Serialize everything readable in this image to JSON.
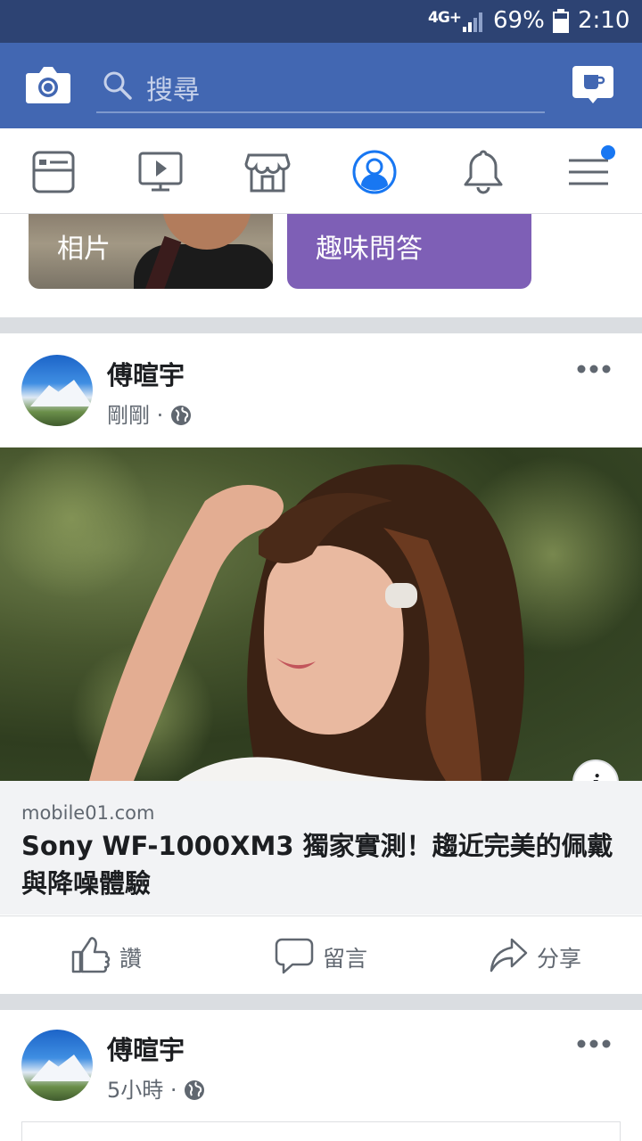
{
  "status_bar": {
    "network": "4G+",
    "battery_percent": "69%",
    "time": "2:10"
  },
  "header": {
    "search_placeholder": "搜尋"
  },
  "nav": {
    "tabs": [
      {
        "icon": "news-feed-icon"
      },
      {
        "icon": "watch-icon"
      },
      {
        "icon": "marketplace-icon"
      },
      {
        "icon": "profile-icon",
        "active": true
      },
      {
        "icon": "notifications-icon"
      },
      {
        "icon": "menu-icon",
        "badge": true
      }
    ],
    "active_color": "#1877f2"
  },
  "story_cards": [
    {
      "label": "相片"
    },
    {
      "label": "趣味問答"
    }
  ],
  "posts": [
    {
      "author": "傅暄宇",
      "time": "剛剛",
      "link": {
        "domain": "mobile01.com",
        "title": "Sony WF-1000XM3 獨家實測！趨近完美的佩戴與降噪體驗"
      },
      "actions": {
        "like": "讚",
        "comment": "留言",
        "share": "分享"
      }
    },
    {
      "author": "傅暄宇",
      "time": "5小時"
    }
  ],
  "colors": {
    "status_bar": "#2d4373",
    "header": "#4267b2",
    "quiz_card": "#7e5fb6"
  }
}
